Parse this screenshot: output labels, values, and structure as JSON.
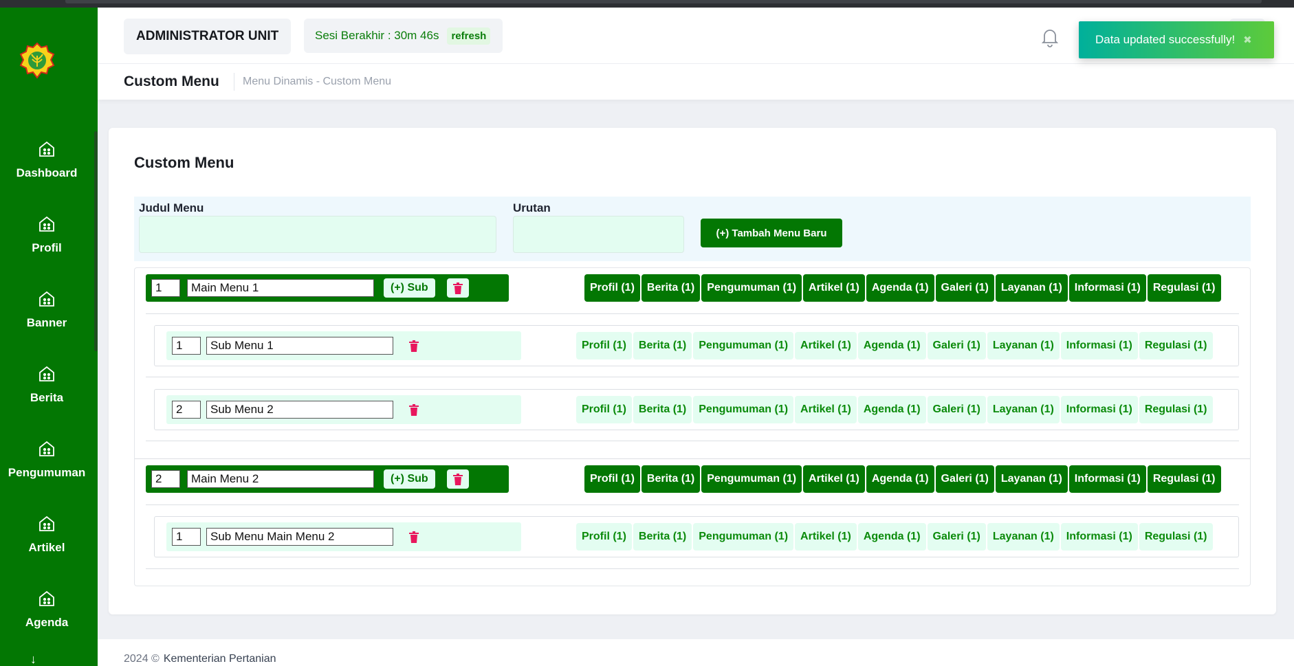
{
  "sidebar": {
    "items": [
      {
        "label": "Dashboard"
      },
      {
        "label": "Profil"
      },
      {
        "label": "Banner"
      },
      {
        "label": "Berita"
      },
      {
        "label": "Pengumuman"
      },
      {
        "label": "Artikel"
      },
      {
        "label": "Agenda"
      }
    ],
    "more_icon": "arrow-down-icon"
  },
  "header": {
    "role": "ADMINISTRATOR UNIT",
    "session_label": "Sesi Berakhir : 30m 46s",
    "refresh_label": "refresh"
  },
  "toast": {
    "message": "Data updated successfully!",
    "close": "✖"
  },
  "subheader": {
    "title": "Custom Menu",
    "breadcrumb": "Menu Dinamis - Custom Menu"
  },
  "card": {
    "title": "Custom Menu",
    "form": {
      "judul_label": "Judul Menu",
      "urutan_label": "Urutan",
      "judul_value": "",
      "urutan_value": "",
      "add_button": "(+) Tambah Menu Baru"
    }
  },
  "menus": [
    {
      "order": "1",
      "name": "Main Menu 1",
      "sub_label": "(+) Sub",
      "categories": [
        "Profil (1)",
        "Berita (1)",
        "Pengumuman (1)",
        "Artikel (1)",
        "Agenda (1)",
        "Galeri (1)",
        "Layanan (1)",
        "Informasi (1)",
        "Regulasi (1)"
      ],
      "subs": [
        {
          "order": "1",
          "name": "Sub Menu 1",
          "categories": [
            "Profil (1)",
            "Berita (1)",
            "Pengumuman (1)",
            "Artikel (1)",
            "Agenda (1)",
            "Galeri (1)",
            "Layanan (1)",
            "Informasi (1)",
            "Regulasi (1)"
          ]
        },
        {
          "order": "2",
          "name": "Sub Menu 2",
          "categories": [
            "Profil (1)",
            "Berita (1)",
            "Pengumuman (1)",
            "Artikel (1)",
            "Agenda (1)",
            "Galeri (1)",
            "Layanan (1)",
            "Informasi (1)",
            "Regulasi (1)"
          ]
        }
      ]
    },
    {
      "order": "2",
      "name": "Main Menu 2",
      "sub_label": "(+) Sub",
      "categories": [
        "Profil (1)",
        "Berita (1)",
        "Pengumuman (1)",
        "Artikel (1)",
        "Agenda (1)",
        "Galeri (1)",
        "Layanan (1)",
        "Informasi (1)",
        "Regulasi (1)"
      ],
      "subs": [
        {
          "order": "1",
          "name": "Sub Menu Main Menu 2",
          "categories": [
            "Profil (1)",
            "Berita (1)",
            "Pengumuman (1)",
            "Artikel (1)",
            "Agenda (1)",
            "Galeri (1)",
            "Layanan (1)",
            "Informasi (1)",
            "Regulasi (1)"
          ]
        }
      ]
    }
  ],
  "footer": {
    "year": "2024 ©",
    "org": "Kementerian Pertanian"
  },
  "colors": {
    "primary": "#037703",
    "accent_light": "#e3fdf1",
    "danger": "#e8175d"
  }
}
